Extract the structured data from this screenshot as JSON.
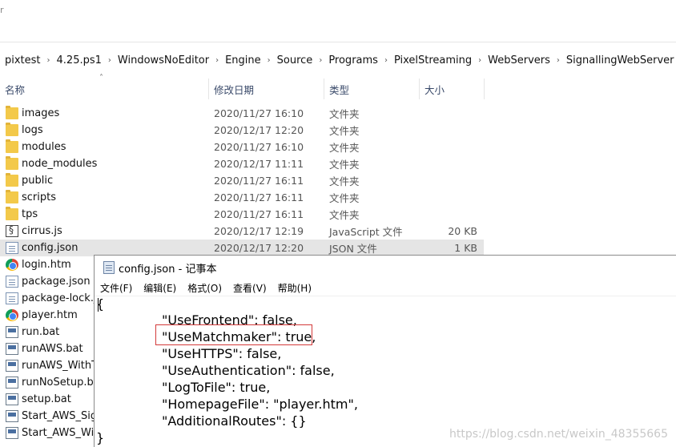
{
  "top_fragment": "r",
  "breadcrumb": [
    "pixtest",
    "4.25.ps1",
    "WindowsNoEditor",
    "Engine",
    "Source",
    "Programs",
    "PixelStreaming",
    "WebServers",
    "SignallingWebServer"
  ],
  "columns": {
    "name": "名称",
    "date": "修改日期",
    "type": "类型",
    "size": "大小"
  },
  "files": [
    {
      "name": "images",
      "date": "2020/11/27 16:10",
      "type": "文件夹",
      "size": "",
      "icon": "folder-icon"
    },
    {
      "name": "logs",
      "date": "2020/12/17 12:20",
      "type": "文件夹",
      "size": "",
      "icon": "folder-icon"
    },
    {
      "name": "modules",
      "date": "2020/11/27 16:10",
      "type": "文件夹",
      "size": "",
      "icon": "folder-icon"
    },
    {
      "name": "node_modules",
      "date": "2020/12/17 11:11",
      "type": "文件夹",
      "size": "",
      "icon": "folder-icon"
    },
    {
      "name": "public",
      "date": "2020/11/27 16:11",
      "type": "文件夹",
      "size": "",
      "icon": "folder-icon"
    },
    {
      "name": "scripts",
      "date": "2020/11/27 16:11",
      "type": "文件夹",
      "size": "",
      "icon": "folder-icon"
    },
    {
      "name": "tps",
      "date": "2020/11/27 16:11",
      "type": "文件夹",
      "size": "",
      "icon": "folder-icon"
    },
    {
      "name": "cirrus.js",
      "date": "2020/12/17 12:19",
      "type": "JavaScript 文件",
      "size": "20 KB",
      "icon": "script-file-icon"
    },
    {
      "name": "config.json",
      "date": "2020/12/17 12:20",
      "type": "JSON 文件",
      "size": "1 KB",
      "icon": "document-icon"
    },
    {
      "name": "login.htm",
      "icon": "chrome-icon"
    },
    {
      "name": "package.json",
      "icon": "document-icon"
    },
    {
      "name": "package-lock.js",
      "icon": "document-icon"
    },
    {
      "name": "player.htm",
      "icon": "chrome-icon"
    },
    {
      "name": "run.bat",
      "icon": "batch-file-icon"
    },
    {
      "name": "runAWS.bat",
      "icon": "batch-file-icon"
    },
    {
      "name": "runAWS_WithTU",
      "icon": "batch-file-icon"
    },
    {
      "name": "runNoSetup.bat",
      "icon": "batch-file-icon"
    },
    {
      "name": "setup.bat",
      "icon": "batch-file-icon"
    },
    {
      "name": "Start_AWS_Sign",
      "icon": "batch-file-icon"
    },
    {
      "name": "Start_AWS_With",
      "icon": "batch-file-icon"
    }
  ],
  "notepad": {
    "title": "config.json - 记事本",
    "menu": [
      "文件(F)",
      "编辑(E)",
      "格式(O)",
      "查看(V)",
      "帮助(H)"
    ],
    "lines": [
      "{",
      "\"UseFrontend\": false,",
      "\"UseMatchmaker\": true,",
      "\"UseHTTPS\": false,",
      "\"UseAuthentication\": false,",
      "\"LogToFile\": true,",
      "\"HomepageFile\": \"player.htm\",",
      "\"AdditionalRoutes\": {}",
      "}"
    ]
  },
  "watermark": "https://blog.csdn.net/weixin_48355665",
  "colors": {
    "selection": "#e5e5e5",
    "highlight_border": "#d33a3a",
    "folder": "#f3c94a"
  }
}
